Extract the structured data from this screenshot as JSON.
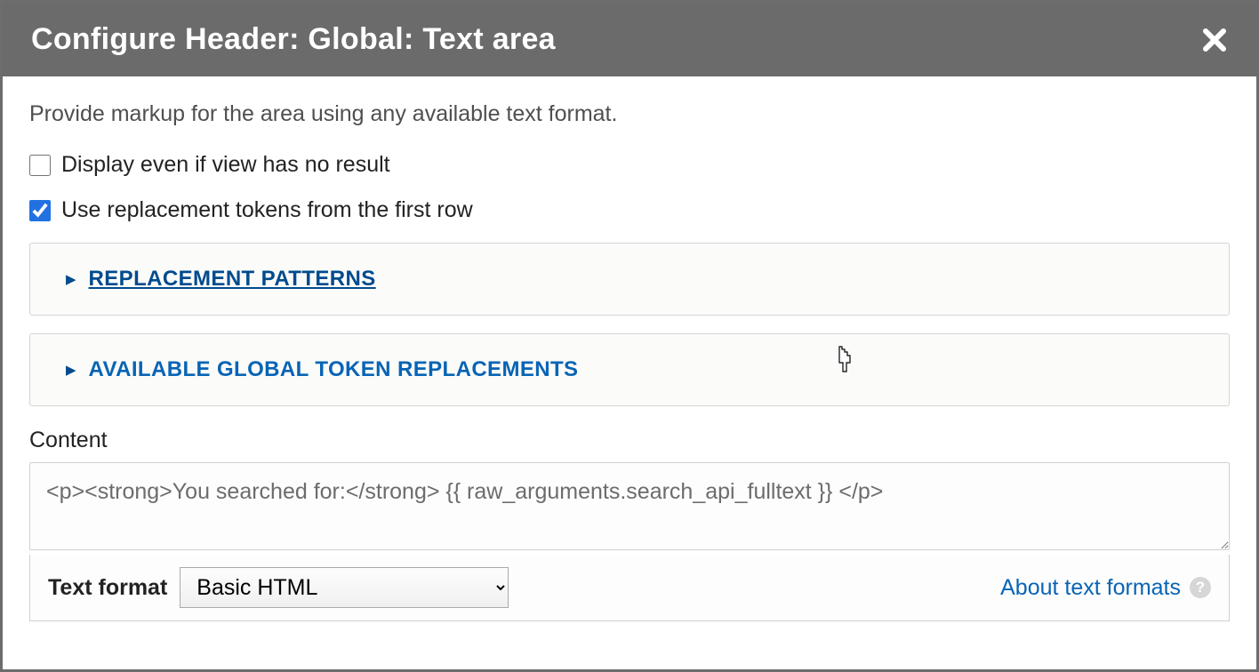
{
  "dialog": {
    "title": "Configure Header: Global: Text area"
  },
  "description": "Provide markup for the area using any available text format.",
  "checkboxes": {
    "display_empty": {
      "label": "Display even if view has no result",
      "checked": false
    },
    "use_tokens": {
      "label": "Use replacement tokens from the first row",
      "checked": true
    }
  },
  "details": {
    "replacement_patterns": "REPLACEMENT PATTERNS",
    "global_tokens": "AVAILABLE GLOBAL TOKEN REPLACEMENTS"
  },
  "content": {
    "label": "Content",
    "value": "<p><strong>You searched for:</strong> {{ raw_arguments.search_api_fulltext }} </p>"
  },
  "text_format": {
    "label": "Text format",
    "selected": "Basic HTML",
    "about_link": "About text formats"
  }
}
